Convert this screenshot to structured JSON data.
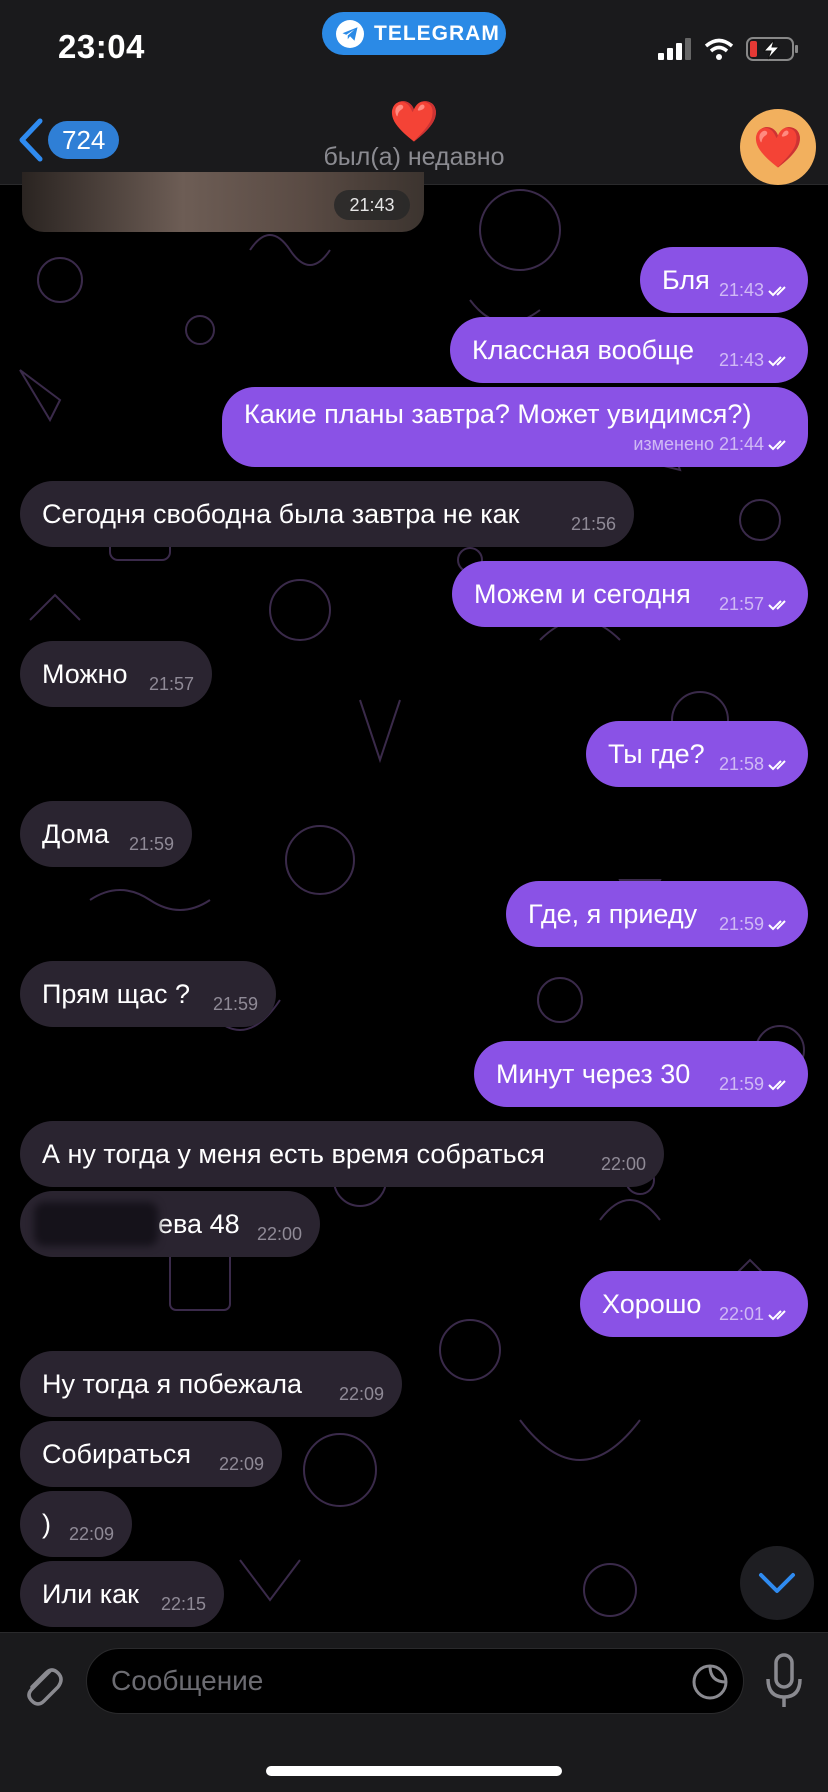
{
  "status_bar": {
    "time": "23:04",
    "app_pill": "TELEGRAM"
  },
  "header": {
    "back_count": "724",
    "title": "❤️",
    "status": "был(а) недавно",
    "avatar": "❤️"
  },
  "photo": {
    "time": "21:43"
  },
  "messages": [
    {
      "dir": "out",
      "text": "Бля",
      "time": "21:43"
    },
    {
      "dir": "out",
      "text": "Классная вообще",
      "time": "21:43"
    },
    {
      "dir": "out",
      "text": "Какие планы завтра? Может увидимся?)",
      "time": "изменено 21:44"
    },
    {
      "dir": "in",
      "text": "Сегодня свободна была завтра не как",
      "time": "21:56"
    },
    {
      "dir": "out",
      "text": "Можем и сегодня",
      "time": "21:57"
    },
    {
      "dir": "in",
      "text": "Можно",
      "time": "21:57"
    },
    {
      "dir": "out",
      "text": "Ты где?",
      "time": "21:58"
    },
    {
      "dir": "in",
      "text": "Дома",
      "time": "21:59"
    },
    {
      "dir": "out",
      "text": "Где, я приеду",
      "time": "21:59"
    },
    {
      "dir": "in",
      "text": "Прям щас ?",
      "time": "21:59"
    },
    {
      "dir": "out",
      "text": "Минут через 30",
      "time": "21:59"
    },
    {
      "dir": "in",
      "text": "А ну тогда у меня есть время собраться",
      "time": "22:00"
    },
    {
      "dir": "in",
      "text": "ева 48",
      "time": "22:00"
    },
    {
      "dir": "out",
      "text": "Хорошо",
      "time": "22:01"
    },
    {
      "dir": "in",
      "text": "Ну тогда я побежала",
      "time": "22:09"
    },
    {
      "dir": "in",
      "text": "Собираться",
      "time": "22:09"
    },
    {
      "dir": "in",
      "text": ")",
      "time": "22:09"
    },
    {
      "dir": "in",
      "text": "Или как",
      "time": "22:15"
    }
  ],
  "composer": {
    "placeholder": "Сообщение"
  },
  "colors": {
    "outgoing": "#8a52e6",
    "incoming": "#2a2430",
    "badge": "#2f7fd6",
    "avatar": "#f2b05e"
  }
}
